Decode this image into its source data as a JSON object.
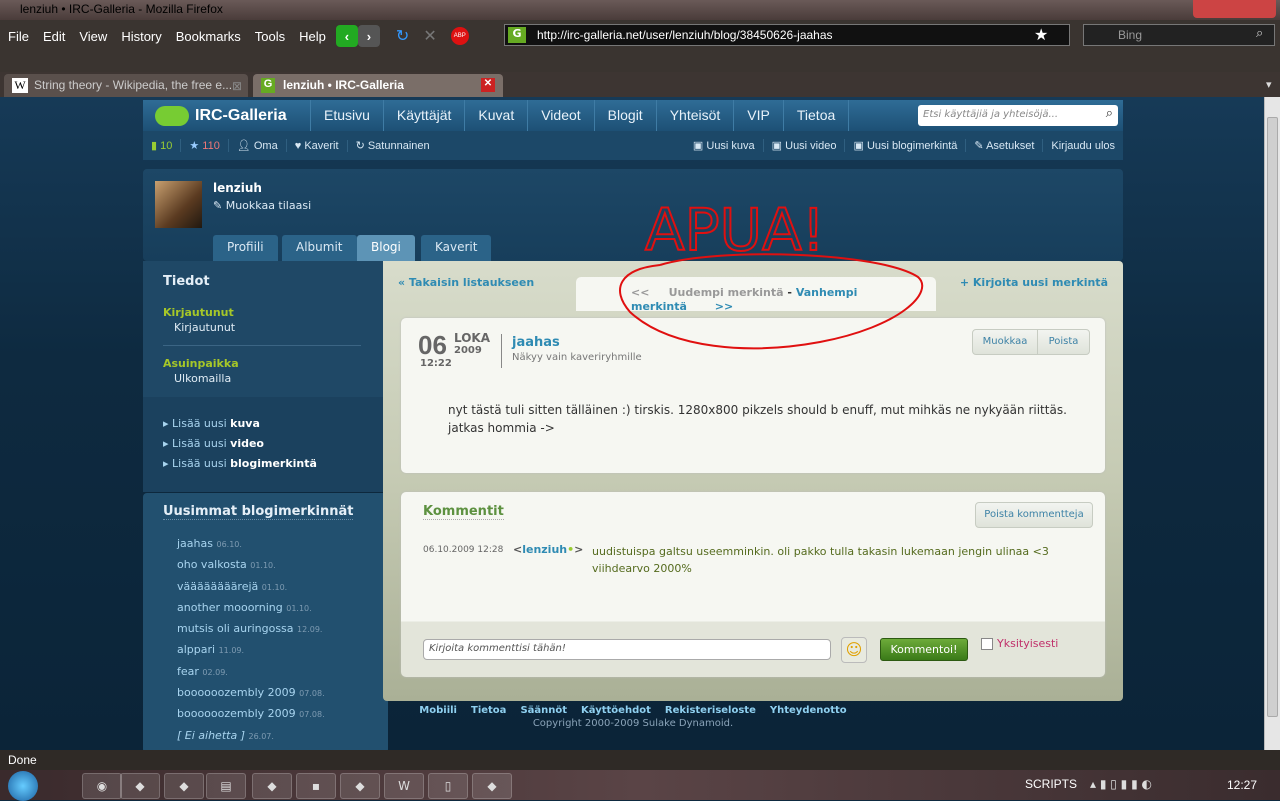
{
  "window": {
    "title": "lenziuh • IRC-Galleria - Mozilla Firefox"
  },
  "menu": [
    "File",
    "Edit",
    "View",
    "History",
    "Bookmarks",
    "Tools",
    "Help"
  ],
  "toolbar": {
    "url": "http://irc-galleria.net/user/lenziuh/blog/38450626-jaahas",
    "search_placeholder": "Bing"
  },
  "tabs": [
    {
      "label": "String theory - Wikipedia, the free e..."
    },
    {
      "label": "lenziuh • IRC-Galleria"
    }
  ],
  "site": {
    "logo": "IRC-Galleria",
    "nav": [
      "Etusivu",
      "Käyttäjät",
      "Kuvat",
      "Videot",
      "Blogit",
      "Yhteisöt",
      "VIP",
      "Tietoa"
    ],
    "search_placeholder": "Etsi käyttäjiä ja yhteisöjä...",
    "sub_left": {
      "count1": "10",
      "count2": "110",
      "oma": "Oma",
      "kaverit": "Kaverit",
      "satunnainen": "Satunnainen"
    },
    "sub_right": [
      "Uusi kuva",
      "Uusi video",
      "Uusi blogimerkintä",
      "Asetukset",
      "Kirjaudu ulos"
    ]
  },
  "profile": {
    "username": "lenziuh",
    "edit_status": "Muokkaa tilaasi",
    "tabs": [
      "Profiili",
      "Albumit",
      "Blogi",
      "Kaverit"
    ]
  },
  "annotation": {
    "text": "APUA!",
    "color": "#e01010"
  },
  "sidebar": {
    "info_title": "Tiedot",
    "fields": [
      {
        "label": "Kirjautunut",
        "value": "Kirjautunut"
      },
      {
        "label": "Asuinpaikka",
        "value": "Ulkomailla"
      }
    ],
    "add_links": [
      {
        "prefix": "Lisää uusi ",
        "bold": "kuva"
      },
      {
        "prefix": "Lisää uusi ",
        "bold": "video"
      },
      {
        "prefix": "Lisää uusi ",
        "bold": "blogimerkintä"
      }
    ],
    "recent_title": "Uusimmat blogimerkinnät",
    "recent": [
      {
        "t": "jaahas",
        "d": "06.10."
      },
      {
        "t": "oho valkosta",
        "d": "01.10."
      },
      {
        "t": "väääääääärejä",
        "d": "01.10."
      },
      {
        "t": "another mooorning",
        "d": "01.10."
      },
      {
        "t": "mutsis oli auringossa",
        "d": "12.09."
      },
      {
        "t": "alppari",
        "d": "11.09."
      },
      {
        "t": "fear",
        "d": "02.09."
      },
      {
        "t": "boooooozembly 2009",
        "d": "07.08."
      },
      {
        "t": "boooooozembly 2009",
        "d": "07.08."
      },
      {
        "t": "[ Ei aihetta ]",
        "d": "26.07."
      }
    ]
  },
  "blog": {
    "back": "« Takaisin listaukseen",
    "new": "+ Kirjoita uusi merkintä",
    "prev_arrow": "<<",
    "newer": "Uudempi merkintä",
    "sep": "-",
    "older": "Vanhempi merkintä",
    "next_arrow": ">>",
    "day": "06",
    "month": "LOKA",
    "year": "2009",
    "time": "12:22",
    "title": "jaahas",
    "visibility": "Näkyy vain kaveriryhmille",
    "edit": "Muokkaa",
    "delete": "Poista",
    "body": "nyt tästä tuli sitten tälläinen :) tirskis. 1280x800 pikzels should b enuff, mut mihkäs ne nykyään riittäs. jatkas hommia ->"
  },
  "comments": {
    "title": "Kommentit",
    "delete_all": "Poista kommentteja",
    "items": [
      {
        "date": "06.10.2009 12:28",
        "author": "<lenziuh",
        "author_end": ">",
        "text": "uudistuispa galtsu useemminkin. oli pakko tulla takasin lukemaan jengin ulinaa <3 viihdearvo 2000%"
      }
    ],
    "input_placeholder": "Kirjoita kommenttisi tähän!",
    "submit": "Kommentoi!",
    "private": "Yksityisesti"
  },
  "footer": {
    "links": [
      "Mobiili",
      "Tietoa",
      "Säännöt",
      "Käyttöehdot",
      "Rekisteriseloste",
      "Yhteydenotto"
    ],
    "copyright": "Copyright 2000-2009 Sulake Dynamoid."
  },
  "status": "Done",
  "taskbar": {
    "scripts": "SCRIPTS",
    "clock": "12:27"
  }
}
